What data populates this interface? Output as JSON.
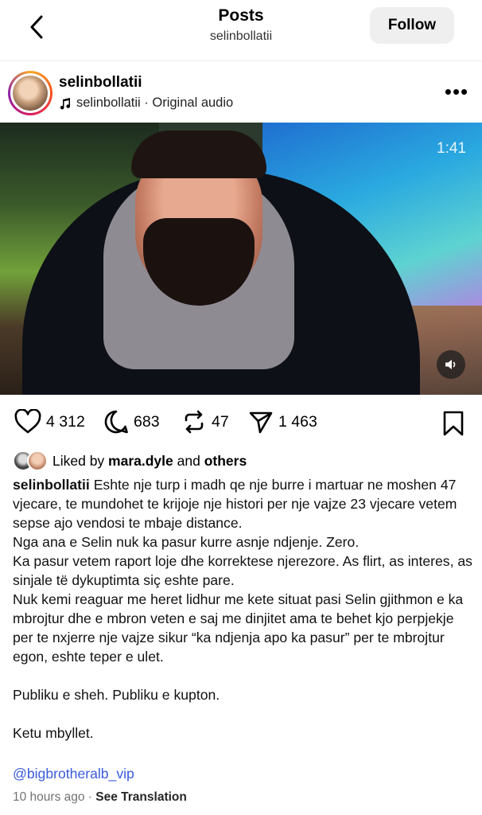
{
  "header": {
    "title": "Posts",
    "subtitle": "selinbollatii",
    "follow_label": "Follow"
  },
  "post": {
    "username": "selinbollatii",
    "audio_label": "selinbollatii · Original audio",
    "video_time": "1:41"
  },
  "actions": {
    "likes": "4 312",
    "comments": "683",
    "reposts": "47",
    "shares": "1 463"
  },
  "liked_by": {
    "prefix": "Liked by ",
    "user": "mara.dyle",
    "middle": " and ",
    "others": "others"
  },
  "caption": {
    "author": "selinbollatii",
    "lines": [
      "Eshte nje turp i madh qe nje burre i martuar ne moshen 47 vjecare, te mundohet te krijoje nje histori per nje vajze 23 vjecare vetem sepse ajo vendosi te mbaje distance.",
      "Nga ana e Selin nuk ka pasur kurre asnje ndjenje. Zero.",
      "Ka pasur vetem raport loje dhe korrektese njerezore. As flirt, as interes, as sinjale të dykuptimta siç eshte pare.",
      "Nuk kemi reaguar me heret lidhur me kete situat pasi Selin gjithmon e ka mbrojtur dhe e mbron veten e saj me dinjitet ama te behet kjo perpjekje per te nxjerre nje vajze sikur “ka ndjenja apo ka pasur” per te mbrojtur egon, eshte teper e ulet.",
      "Publiku e sheh. Publiku e kupton.",
      "Ketu mbyllet."
    ],
    "mention": "@bigbrotheralb_vip"
  },
  "meta": {
    "time": "10 hours ago",
    "separator": " · ",
    "translate": "See Translation"
  }
}
